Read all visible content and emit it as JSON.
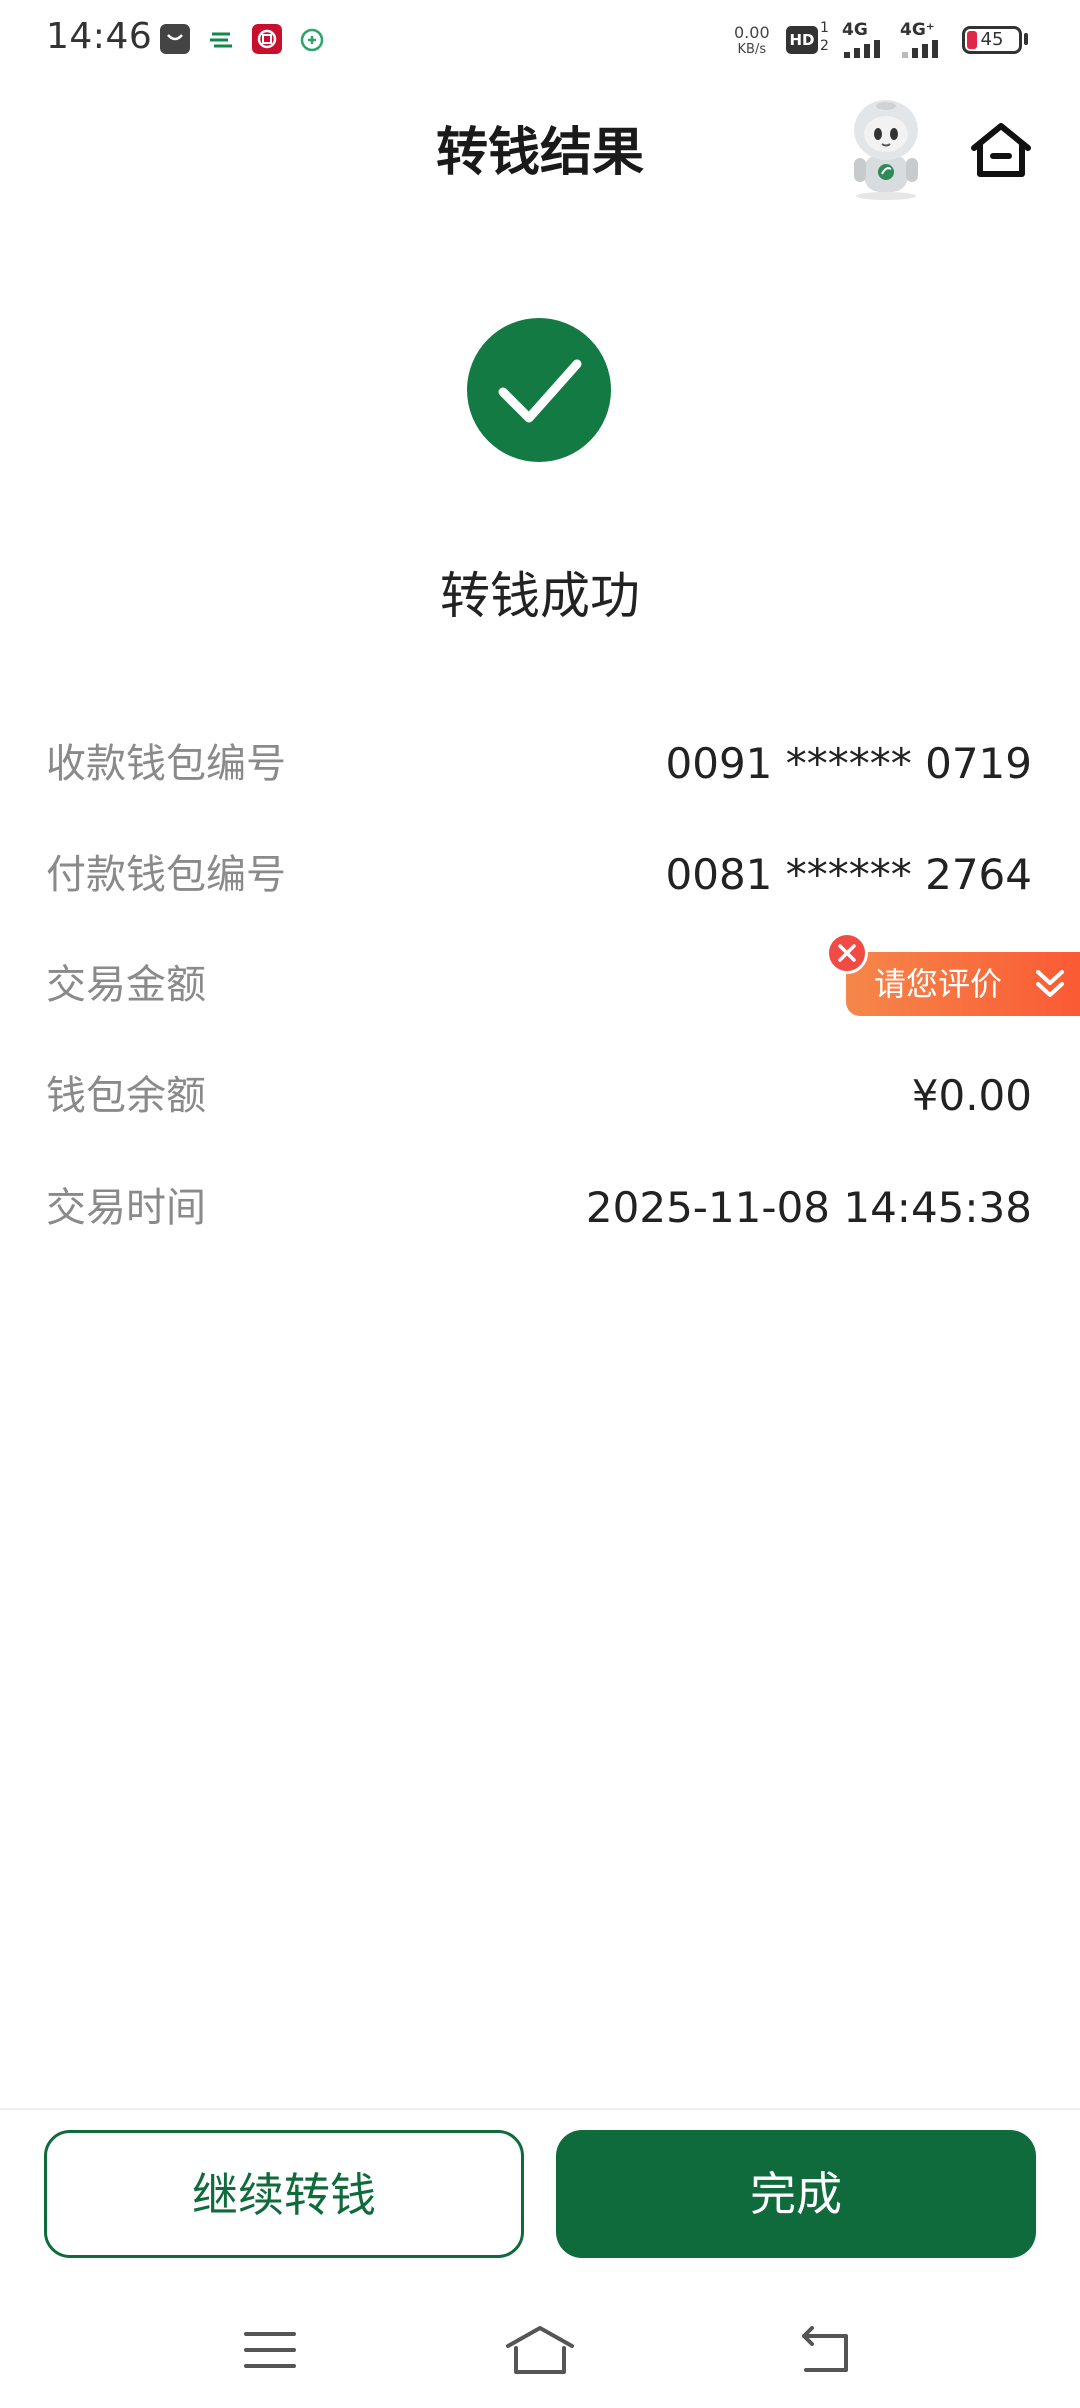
{
  "status_bar": {
    "time": "14:46",
    "net_speed_value": "0.00",
    "net_speed_unit": "KB/s",
    "hd_label": "HD",
    "sim1_label": "1",
    "sim2_label": "2",
    "sim1_network": "4G",
    "sim2_network": "4G⁺",
    "battery": "45",
    "app_icons": [
      "messaging-app-icon",
      "china-post-icon",
      "bank-of-china-icon",
      "wallet-app-icon"
    ]
  },
  "header": {
    "title": "转钱结果"
  },
  "result": {
    "message": "转钱成功"
  },
  "details": [
    {
      "label": "收款钱包编号",
      "value": "0091 ****** 0719"
    },
    {
      "label": "付款钱包编号",
      "value": "0081 ****** 2764"
    },
    {
      "label": "交易金额",
      "value": ""
    },
    {
      "label": "钱包余额",
      "value": "¥0.00"
    },
    {
      "label": "交易时间",
      "value": "2025-11-08 14:45:38"
    }
  ],
  "rating_popup": {
    "label": "请您评价"
  },
  "buttons": {
    "continue_label": "继续转钱",
    "done_label": "完成"
  },
  "colors": {
    "brand_green": "#0f6b3c",
    "rating_orange": "#fa6a3c",
    "close_red": "#f24a44"
  }
}
